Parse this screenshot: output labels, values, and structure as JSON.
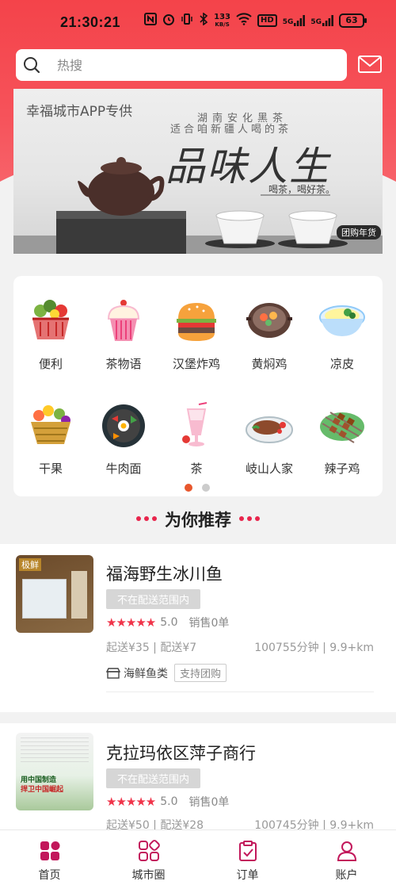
{
  "status_bar": {
    "time": "21:30:21",
    "net_speed_top": "133",
    "net_speed_unit": "KB/S",
    "hd_label": "HD",
    "signal1": "5G",
    "signal2": "5G",
    "battery": "63"
  },
  "search": {
    "placeholder": "热搜"
  },
  "banner": {
    "tag": "幸福城市APP专供",
    "line1": "湖南安化黑茶",
    "line2": "适合咱新疆人喝的茶",
    "headline": "品味人生",
    "slogan": "喝茶，喝好茶。",
    "button": "团购年货"
  },
  "categories": [
    {
      "label": "便利",
      "icon": "vegetable-basket-icon"
    },
    {
      "label": "茶物语",
      "icon": "cupcake-icon"
    },
    {
      "label": "汉堡炸鸡",
      "icon": "burger-icon"
    },
    {
      "label": "黄焖鸡",
      "icon": "claypot-icon"
    },
    {
      "label": "凉皮",
      "icon": "noodle-bowl-icon"
    },
    {
      "label": "干果",
      "icon": "fruit-basket-icon"
    },
    {
      "label": "牛肉面",
      "icon": "bibimbap-icon"
    },
    {
      "label": "茶",
      "icon": "drink-glass-icon"
    },
    {
      "label": "岐山人家",
      "icon": "steak-plate-icon"
    },
    {
      "label": "辣子鸡",
      "icon": "skewers-icon"
    }
  ],
  "section_title": "为你推荐",
  "shops": [
    {
      "name": "福海野生冰川鱼",
      "range": "不在配送范围内",
      "stars": "★★★★★",
      "score": "5.0",
      "sales": "销售0单",
      "fee": "起送¥35 | 配送¥7",
      "distance": "100755分钟 | 9.9+km",
      "category": "海鲜鱼类",
      "group_buy": "支持团购",
      "thumb_text": "极鲜"
    },
    {
      "name": "克拉玛依区萍子商行",
      "range": "不在配送范围内",
      "stars": "★★★★★",
      "score": "5.0",
      "sales": "销售0单",
      "fee": "起送¥50 | 配送¥28",
      "distance": "100745分钟 | 9.9+km",
      "thumb_line1": "用中国制造",
      "thumb_line2": "捍卫中国崛起"
    }
  ],
  "bottom_nav": [
    {
      "label": "首页",
      "icon": "home-grid-icon",
      "active": true
    },
    {
      "label": "城市圈",
      "icon": "city-circle-icon",
      "active": false
    },
    {
      "label": "订单",
      "icon": "order-clipboard-icon",
      "active": false
    },
    {
      "label": "账户",
      "icon": "account-person-icon",
      "active": false
    }
  ],
  "colors": {
    "accent": "#f4434a",
    "nav_active": "#c2185b",
    "star": "#f0344a",
    "indicator": "#e8572d"
  }
}
